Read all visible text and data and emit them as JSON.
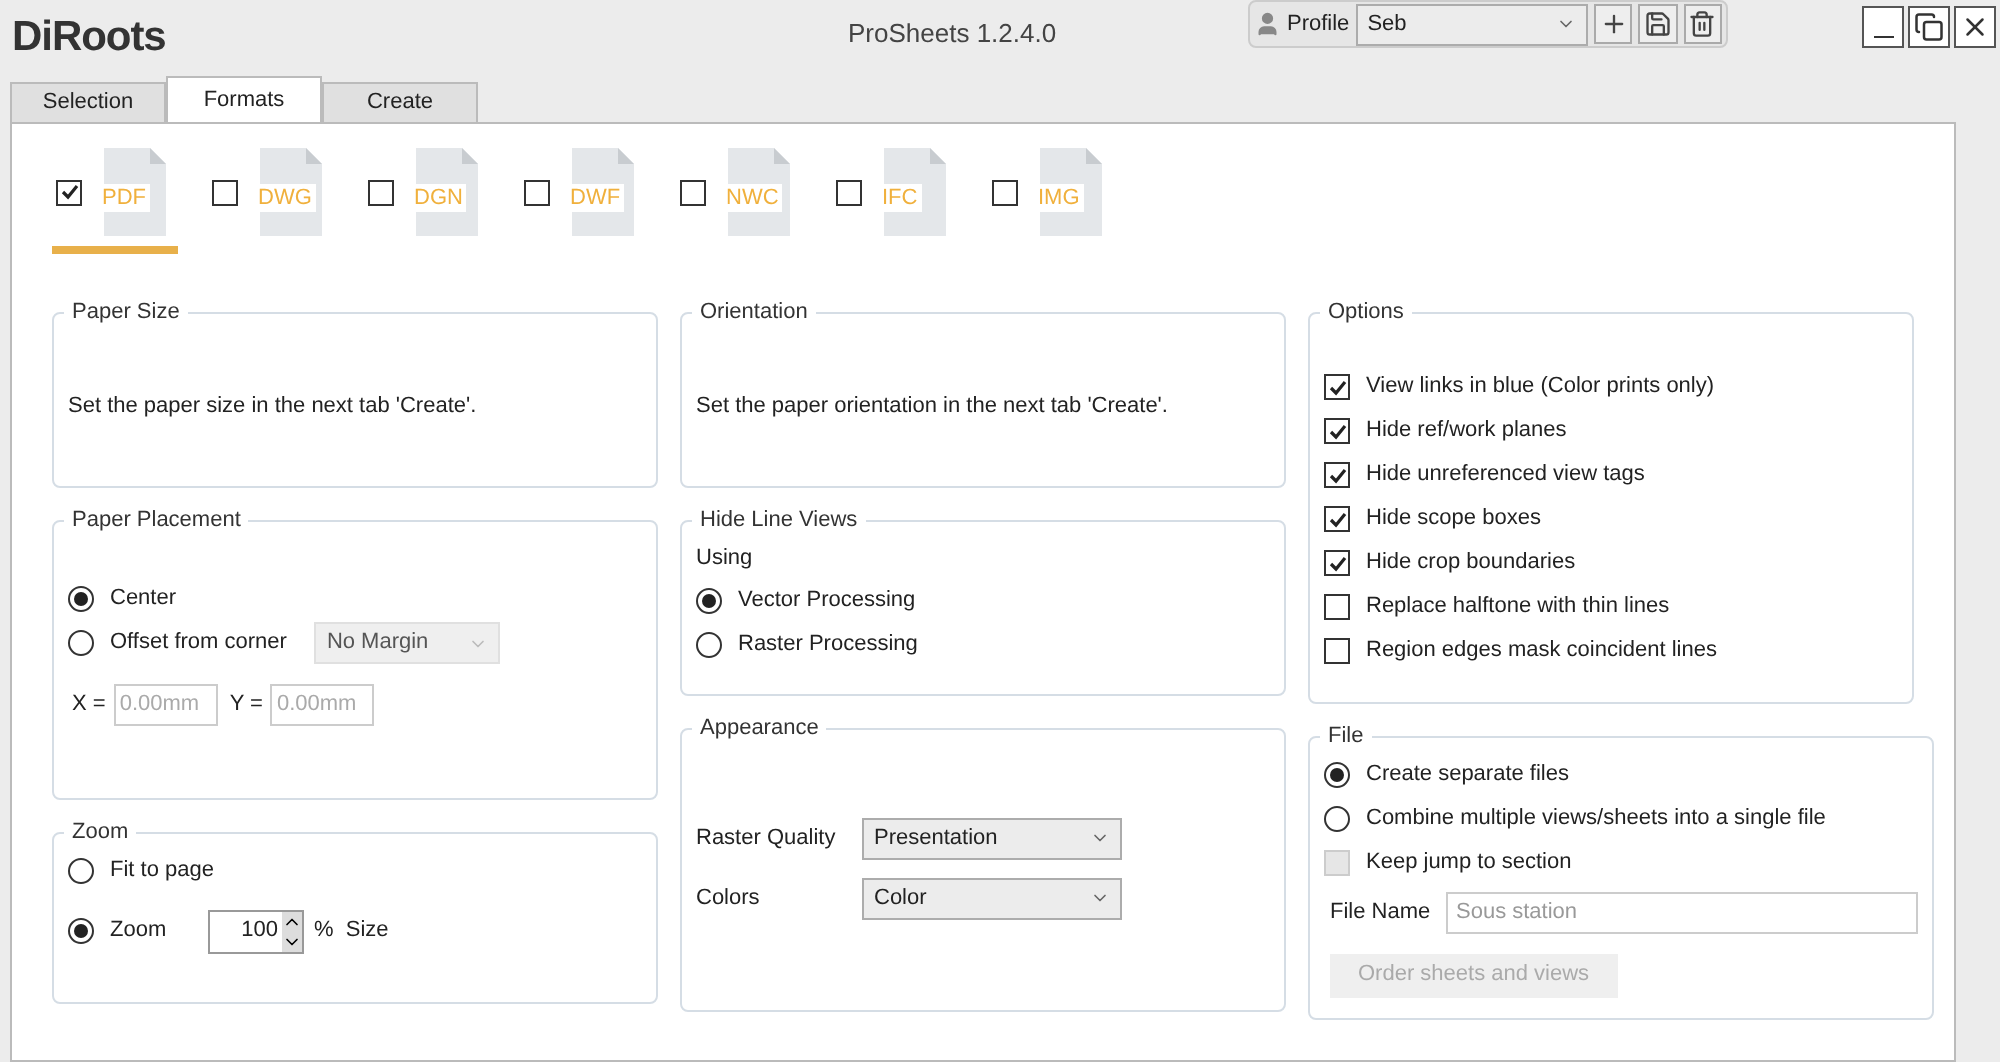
{
  "app": {
    "logo": "DiRoots",
    "title": "ProSheets 1.2.4.0"
  },
  "profile": {
    "label": "Profile",
    "value": "Seb"
  },
  "tabs": [
    {
      "label": "Selection",
      "selected": false
    },
    {
      "label": "Formats",
      "selected": true
    },
    {
      "label": "Create",
      "selected": false
    }
  ],
  "formats": [
    {
      "label": "PDF",
      "checked": true,
      "selected": true
    },
    {
      "label": "DWG",
      "checked": false,
      "selected": false
    },
    {
      "label": "DGN",
      "checked": false,
      "selected": false
    },
    {
      "label": "DWF",
      "checked": false,
      "selected": false
    },
    {
      "label": "NWC",
      "checked": false,
      "selected": false
    },
    {
      "label": "IFC",
      "checked": false,
      "selected": false
    },
    {
      "label": "IMG",
      "checked": false,
      "selected": false
    }
  ],
  "paper_size": {
    "title": "Paper Size",
    "text": "Set the paper size in the next tab 'Create'."
  },
  "paper_placement": {
    "title": "Paper Placement",
    "options": [
      {
        "label": "Center",
        "selected": true
      },
      {
        "label": "Offset from corner",
        "selected": false
      }
    ],
    "margin": {
      "value": "No Margin",
      "disabled": true
    },
    "x": {
      "label": "X =",
      "placeholder": "0.00mm"
    },
    "y": {
      "label": "Y =",
      "placeholder": "0.00mm"
    }
  },
  "zoom": {
    "title": "Zoom",
    "options": [
      {
        "label": "Fit to page",
        "selected": false
      },
      {
        "label": "Zoom",
        "selected": true
      }
    ],
    "value": "100",
    "unit": "%  Size"
  },
  "orientation": {
    "title": "Orientation",
    "text": "Set the paper orientation in the next tab 'Create'."
  },
  "hide_line_views": {
    "title": "Hide Line Views",
    "caption": "Using",
    "options": [
      {
        "label": "Vector Processing",
        "selected": true
      },
      {
        "label": "Raster Processing",
        "selected": false
      }
    ]
  },
  "appearance": {
    "title": "Appearance",
    "fields": [
      {
        "label": "Raster Quality",
        "value": "Presentation"
      },
      {
        "label": "Colors",
        "value": "Color"
      }
    ]
  },
  "options": {
    "title": "Options",
    "items": [
      {
        "label": "View links in blue (Color prints only)",
        "checked": true
      },
      {
        "label": "Hide ref/work planes",
        "checked": true
      },
      {
        "label": "Hide unreferenced view tags",
        "checked": true
      },
      {
        "label": "Hide scope boxes",
        "checked": true
      },
      {
        "label": "Hide crop boundaries",
        "checked": true
      },
      {
        "label": "Replace halftone with thin lines",
        "checked": false
      },
      {
        "label": "Region edges mask coincident lines",
        "checked": false
      }
    ]
  },
  "file": {
    "title": "File",
    "options": [
      {
        "label": "Create separate files",
        "selected": true
      },
      {
        "label": "Combine multiple views/sheets into a single file",
        "selected": false
      }
    ],
    "keep_jump": {
      "label": "Keep jump to section",
      "checked": false,
      "disabled": true
    },
    "file_name": {
      "label": "File Name",
      "placeholder": "Sous station"
    },
    "order_button": {
      "label": "Order sheets and views",
      "disabled": true
    }
  }
}
